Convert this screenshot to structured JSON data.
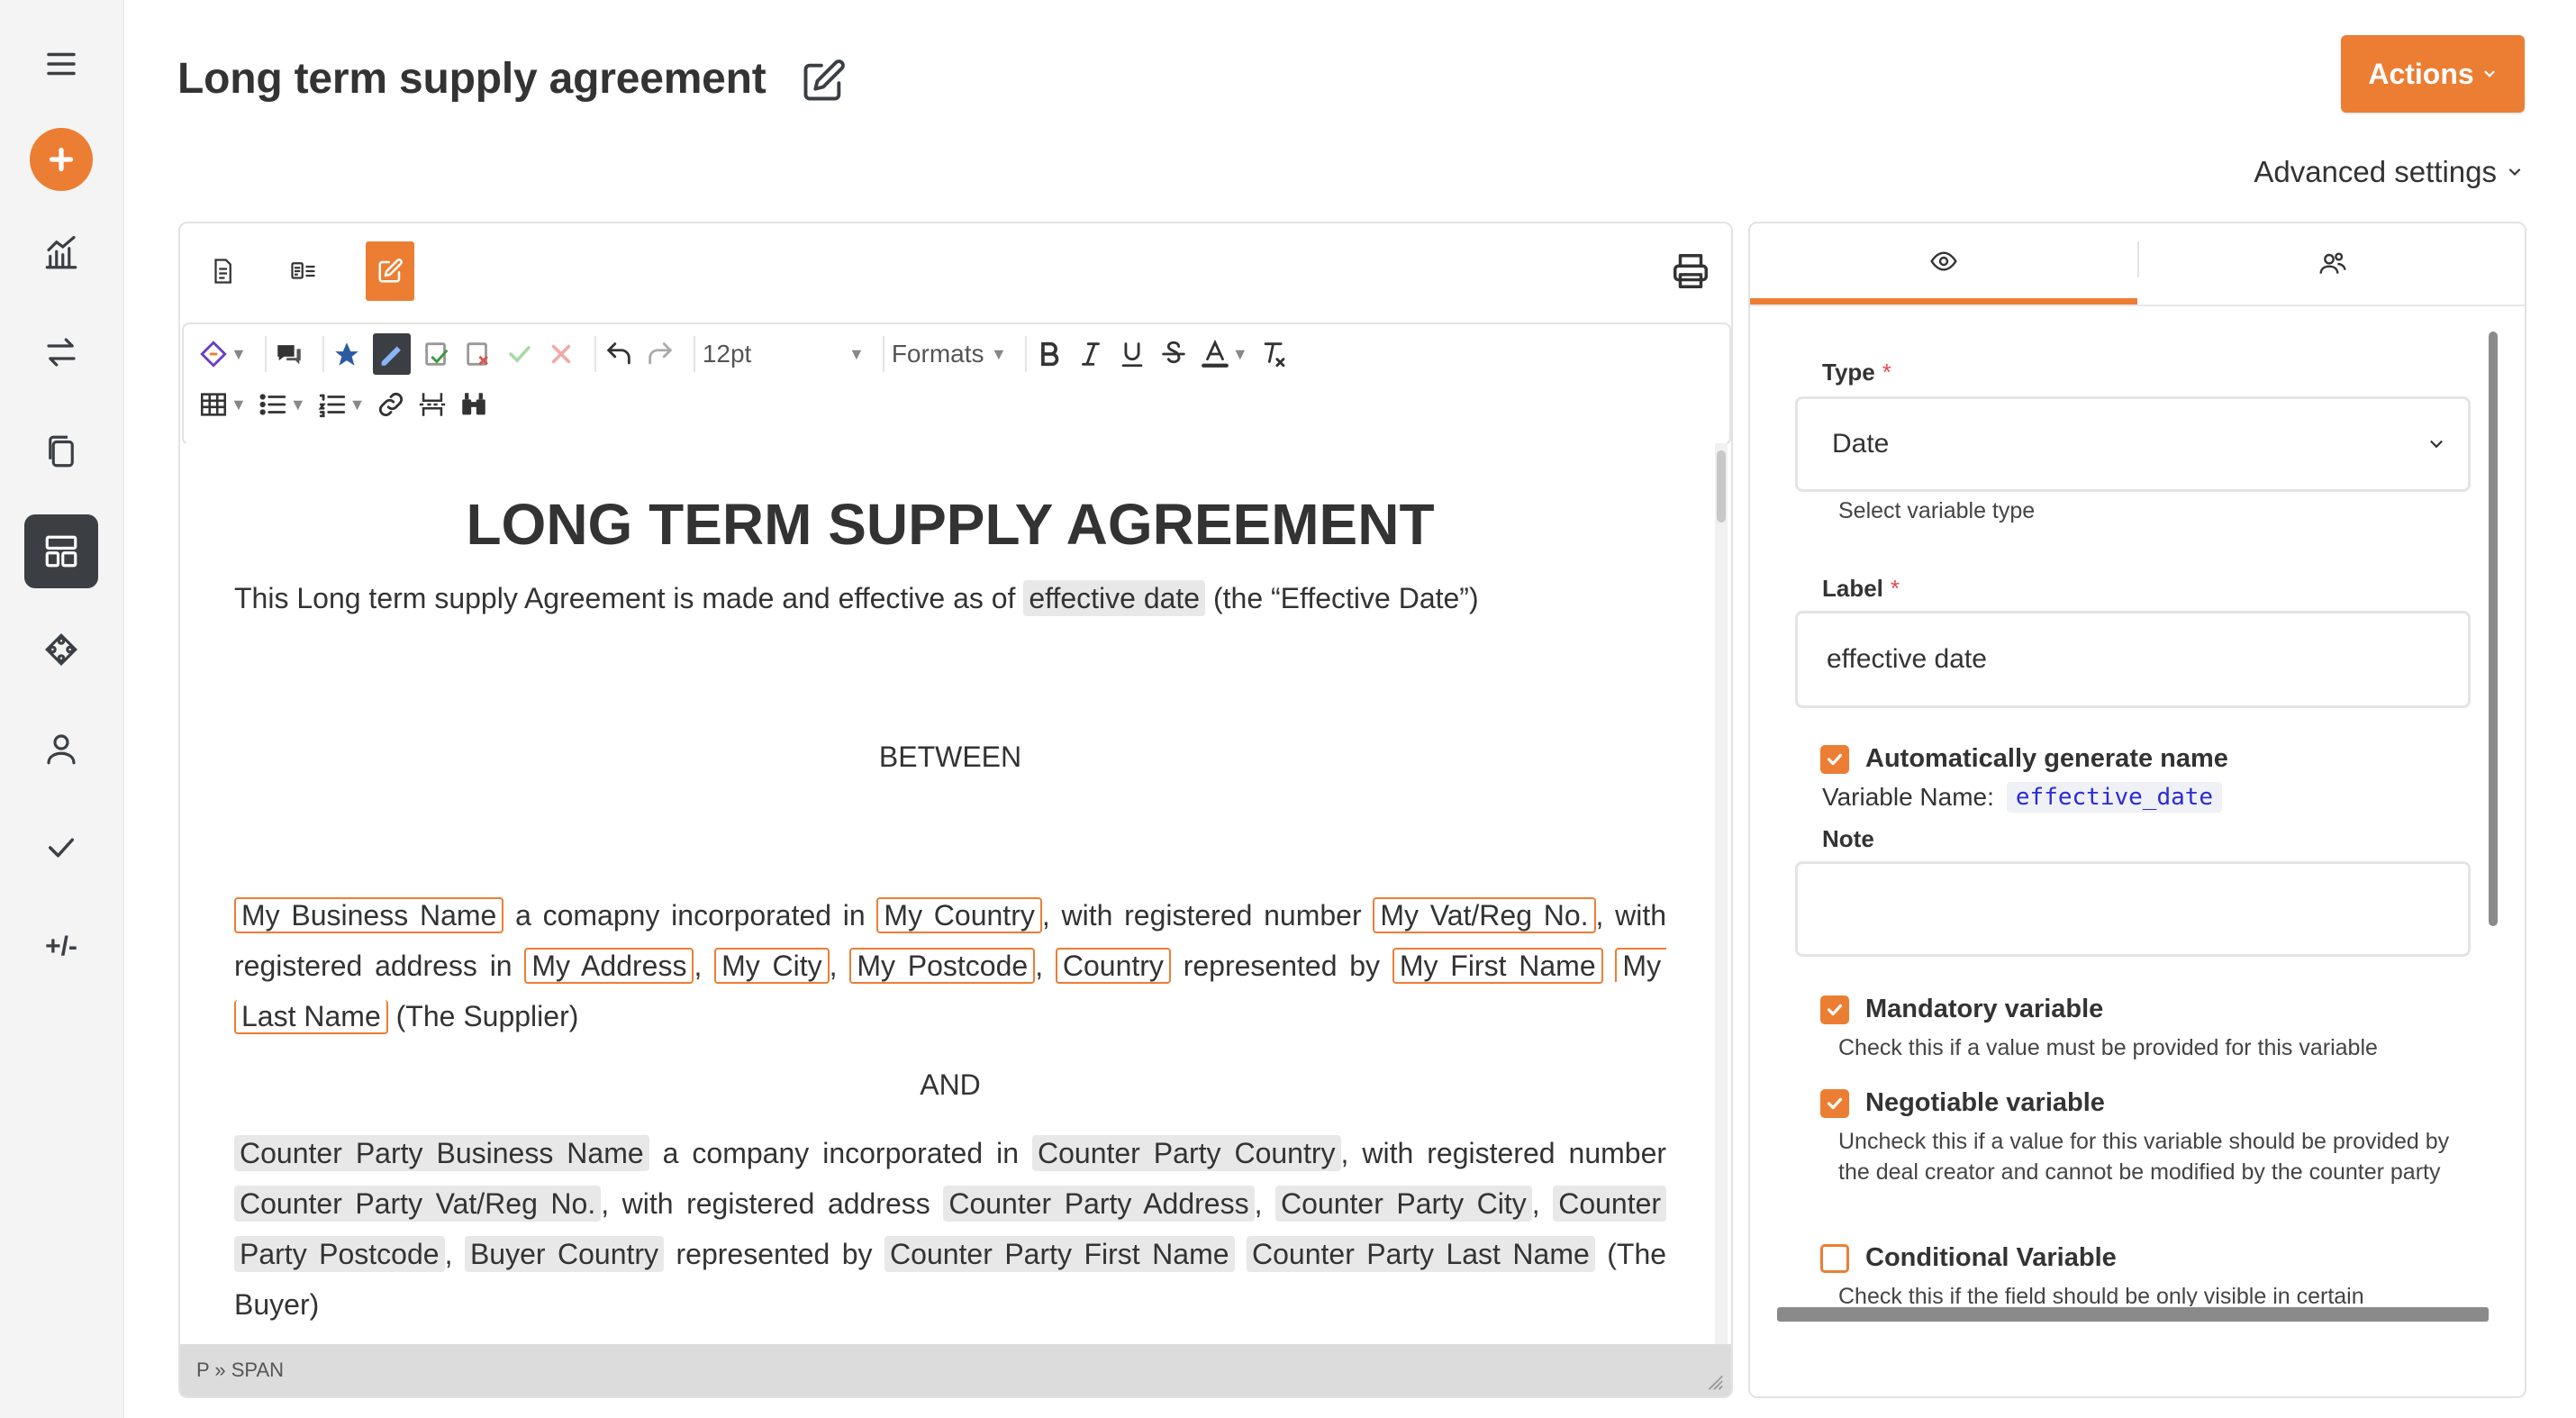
{
  "document": {
    "title": "Long term supply agreement"
  },
  "header": {
    "actions_label": "Actions",
    "advanced_settings_label": "Advanced settings"
  },
  "sidebar": {
    "items": [
      "menu-icon",
      "add-icon",
      "analytics-icon",
      "transfer-icon",
      "documents-icon",
      "dashboard-icon",
      "integrations-icon",
      "user-icon",
      "check-icon",
      "diff-icon"
    ],
    "diff_label": "+/-"
  },
  "editor": {
    "toolbar": {
      "font_size": "12pt",
      "formats_label": "Formats"
    },
    "content": {
      "heading": "LONG TERM SUPPLY AGREEMENT",
      "intro_before": "This Long term supply Agreement is made and effective as of",
      "intro_var": "effective date",
      "intro_after": "(the “Effective Date”)",
      "between": "BETWEEN",
      "and": "AND",
      "supplier": {
        "business_name": "My Business Name",
        "t1": "a comapny incorporated in",
        "country": "My Country",
        "t2": ", with registered number",
        "vat": "My Vat/Reg No.",
        "t3": ", with registered address in",
        "address": "My Address",
        "sep": ",",
        "city": "My City",
        "postcode": "My Postcode",
        "country2": "Country",
        "t4": "represented by",
        "first_name": "My First Name",
        "last_name_a": "My",
        "last_name_b": "Last Name",
        "t5": "(The Supplier)"
      },
      "buyer": {
        "business_name": "Counter Party Business Name",
        "t1": "a company incorporated in",
        "country": "Counter Party Country",
        "t2": ", with registered number",
        "vat": "Counter Party Vat/Reg No.",
        "t3": ", with registered address",
        "address": "Counter Party Address",
        "sep": ",",
        "city": "Counter Party City",
        "postcode_a": "Counter",
        "postcode_b": "Party Postcode",
        "country2": "Buyer Country",
        "t4": "represented by",
        "first_name": "Counter Party First Name",
        "last_name": "Counter Party Last Name",
        "t5": "(The Buyer)"
      }
    },
    "status_path": "P » SPAN"
  },
  "variable_panel": {
    "type_label": "Type",
    "type_value": "Date",
    "type_help": "Select variable type",
    "label_label": "Label",
    "label_value": "effective date",
    "required_mark": "*",
    "auto_name_label": "Automatically generate name",
    "auto_name_checked": true,
    "variable_name_label": "Variable Name:",
    "variable_name_value": "effective_date",
    "note_label": "Note",
    "note_value": "",
    "mandatory_label": "Mandatory variable",
    "mandatory_checked": true,
    "mandatory_help": "Check this if a value must be provided for this variable",
    "negotiable_label": "Negotiable variable",
    "negotiable_checked": true,
    "negotiable_help": "Uncheck this if a value for this variable should be provided by the deal creator and cannot be modified by the counter party",
    "conditional_label": "Conditional Variable",
    "conditional_checked": false,
    "conditional_help": "Check this if the field should be only visible in certain"
  },
  "colors": {
    "accent": "#ec7e34",
    "sidebar_active": "#3b3f44",
    "variable_bg": "#e8e8e8",
    "code_text": "#2a2ad6"
  }
}
